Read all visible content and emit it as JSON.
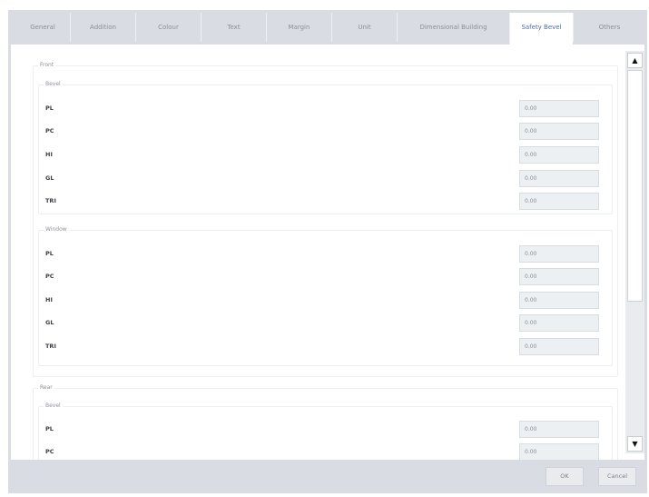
{
  "tabs": [
    {
      "label": "General"
    },
    {
      "label": "Addition"
    },
    {
      "label": "Colour"
    },
    {
      "label": "Text"
    },
    {
      "label": "Margin"
    },
    {
      "label": "Unit"
    },
    {
      "label": "Dimensional Building"
    },
    {
      "label": "Safety Bevel"
    },
    {
      "label": "Others"
    }
  ],
  "active_tab": "Safety Bevel",
  "front": {
    "label": "Front",
    "bevel": {
      "label": "Bevel",
      "rows": [
        {
          "label": "PL",
          "value": "0.00"
        },
        {
          "label": "PC",
          "value": "0.00"
        },
        {
          "label": "HI",
          "value": "0.00"
        },
        {
          "label": "GL",
          "value": "0.00"
        },
        {
          "label": "TRI",
          "value": "0.00"
        }
      ]
    },
    "window": {
      "label": "Window",
      "rows": [
        {
          "label": "PL",
          "value": "0.00"
        },
        {
          "label": "PC",
          "value": "0.00"
        },
        {
          "label": "HI",
          "value": "0.00"
        },
        {
          "label": "GL",
          "value": "0.00"
        },
        {
          "label": "TRI",
          "value": "0.00"
        }
      ]
    }
  },
  "rear": {
    "label": "Rear",
    "bevel": {
      "label": "Bevel",
      "rows": [
        {
          "label": "PL",
          "value": "0.00"
        },
        {
          "label": "PC",
          "value": "0.00"
        }
      ]
    }
  },
  "scrollbar": {
    "up_glyph": "▲",
    "down_glyph": "▼"
  },
  "footer": {
    "ok_label": "OK",
    "cancel_label": "Cancel"
  }
}
